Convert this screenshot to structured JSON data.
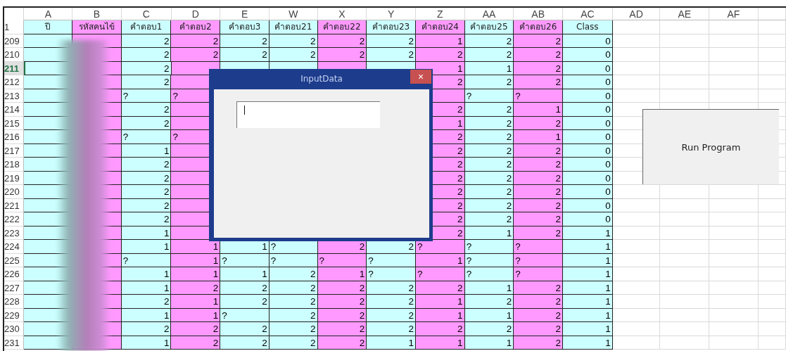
{
  "columns": [
    {
      "letter": "A",
      "header": "ปี",
      "color": "#ccffff"
    },
    {
      "letter": "B",
      "header": "รหัสคนไข้",
      "color": "#ff99ff"
    },
    {
      "letter": "C",
      "header": "คำตอบ1",
      "color": "#ccffff"
    },
    {
      "letter": "D",
      "header": "คำตอบ2",
      "color": "#ff99ff"
    },
    {
      "letter": "E",
      "header": "คำตอบ3",
      "color": "#ccffff"
    },
    {
      "letter": "W",
      "header": "คำตอบ21",
      "color": "#ccffff"
    },
    {
      "letter": "X",
      "header": "คำตอบ22",
      "color": "#ff99ff"
    },
    {
      "letter": "Y",
      "header": "คำตอบ23",
      "color": "#ccffff"
    },
    {
      "letter": "Z",
      "header": "คำตอบ24",
      "color": "#ff99ff"
    },
    {
      "letter": "AA",
      "header": "คำตอบ25",
      "color": "#ccffff"
    },
    {
      "letter": "AB",
      "header": "คำตอบ26",
      "color": "#ff99ff"
    },
    {
      "letter": "AC",
      "header": "Class",
      "color": "#ccffff"
    }
  ],
  "extra_columns": [
    "AD",
    "AE",
    "AF"
  ],
  "header_row": "1",
  "rows": [
    {
      "number": "209",
      "selected": false,
      "cells": [
        null,
        null,
        "2",
        "2",
        "2",
        "2",
        "2",
        "2",
        "1",
        "2",
        "2",
        "0"
      ]
    },
    {
      "number": "210",
      "selected": false,
      "cells": [
        null,
        null,
        "2",
        "2",
        "2",
        "2",
        "2",
        "2",
        "2",
        "2",
        "2",
        "0"
      ]
    },
    {
      "number": "211",
      "selected": true,
      "cells": [
        null,
        null,
        "2",
        null,
        null,
        null,
        null,
        null,
        "1",
        "1",
        "2",
        "0"
      ]
    },
    {
      "number": "212",
      "selected": false,
      "cells": [
        null,
        null,
        "2",
        null,
        null,
        null,
        null,
        null,
        "2",
        "2",
        "2",
        "0"
      ]
    },
    {
      "number": "213",
      "selected": false,
      "cells": [
        null,
        null,
        "?",
        "?",
        null,
        null,
        null,
        null,
        null,
        "?",
        "?",
        "0"
      ]
    },
    {
      "number": "214",
      "selected": false,
      "cells": [
        null,
        null,
        "2",
        null,
        null,
        null,
        null,
        null,
        "2",
        "2",
        "1",
        "0"
      ]
    },
    {
      "number": "215",
      "selected": false,
      "cells": [
        null,
        null,
        "2",
        null,
        null,
        null,
        null,
        null,
        "1",
        "2",
        "2",
        "0"
      ]
    },
    {
      "number": "216",
      "selected": false,
      "cells": [
        null,
        null,
        "?",
        "?",
        null,
        null,
        null,
        null,
        "2",
        "2",
        "1",
        "0"
      ]
    },
    {
      "number": "217",
      "selected": false,
      "cells": [
        null,
        null,
        "1",
        null,
        null,
        null,
        null,
        null,
        "2",
        "2",
        "2",
        "0"
      ]
    },
    {
      "number": "218",
      "selected": false,
      "cells": [
        null,
        null,
        "2",
        null,
        null,
        null,
        null,
        null,
        "2",
        "2",
        "2",
        "0"
      ]
    },
    {
      "number": "219",
      "selected": false,
      "cells": [
        null,
        null,
        "2",
        null,
        null,
        null,
        null,
        null,
        "2",
        "2",
        "2",
        "0"
      ]
    },
    {
      "number": "220",
      "selected": false,
      "cells": [
        null,
        null,
        "2",
        null,
        null,
        null,
        null,
        null,
        "2",
        "2",
        "2",
        "0"
      ]
    },
    {
      "number": "221",
      "selected": false,
      "cells": [
        null,
        null,
        "2",
        null,
        null,
        null,
        null,
        null,
        "2",
        "2",
        "2",
        "0"
      ]
    },
    {
      "number": "222",
      "selected": false,
      "cells": [
        null,
        null,
        "2",
        null,
        null,
        null,
        null,
        null,
        "2",
        "2",
        "2",
        "0"
      ]
    },
    {
      "number": "223",
      "selected": false,
      "cells": [
        null,
        null,
        "1",
        null,
        null,
        null,
        null,
        null,
        "2",
        "1",
        "2",
        "1"
      ]
    },
    {
      "number": "224",
      "selected": false,
      "cells": [
        null,
        null,
        "1",
        "1",
        "1",
        "?",
        "2",
        "2",
        "?",
        "?",
        "?",
        "1"
      ]
    },
    {
      "number": "225",
      "selected": false,
      "cells": [
        null,
        null,
        "?",
        "1",
        "?",
        "?",
        "?",
        "?",
        "1",
        "?",
        "?",
        "1"
      ]
    },
    {
      "number": "226",
      "selected": false,
      "cells": [
        null,
        null,
        "1",
        "1",
        "1",
        "2",
        "1",
        "?",
        "?",
        "?",
        "?",
        "1"
      ]
    },
    {
      "number": "227",
      "selected": false,
      "cells": [
        null,
        null,
        "1",
        "2",
        "2",
        "2",
        "2",
        "2",
        "2",
        "1",
        "2",
        "1"
      ]
    },
    {
      "number": "228",
      "selected": false,
      "cells": [
        null,
        null,
        "2",
        "1",
        "2",
        "2",
        "2",
        "2",
        "1",
        "2",
        "2",
        "1"
      ]
    },
    {
      "number": "229",
      "selected": false,
      "cells": [
        null,
        null,
        "1",
        "1",
        "?",
        "2",
        "2",
        "2",
        "1",
        "1",
        "2",
        "1"
      ]
    },
    {
      "number": "230",
      "selected": false,
      "cells": [
        null,
        null,
        "2",
        "2",
        "2",
        "2",
        "2",
        "2",
        "2",
        "2",
        "2",
        "1"
      ]
    },
    {
      "number": "231",
      "selected": false,
      "cells": [
        null,
        null,
        "1",
        "2",
        "2",
        "2",
        "2",
        "1",
        "1",
        "1",
        "2",
        "1"
      ]
    }
  ],
  "dialog": {
    "title": "InputData",
    "close": "×",
    "input": {
      "focused": true
    }
  },
  "run_button": "Run Program"
}
